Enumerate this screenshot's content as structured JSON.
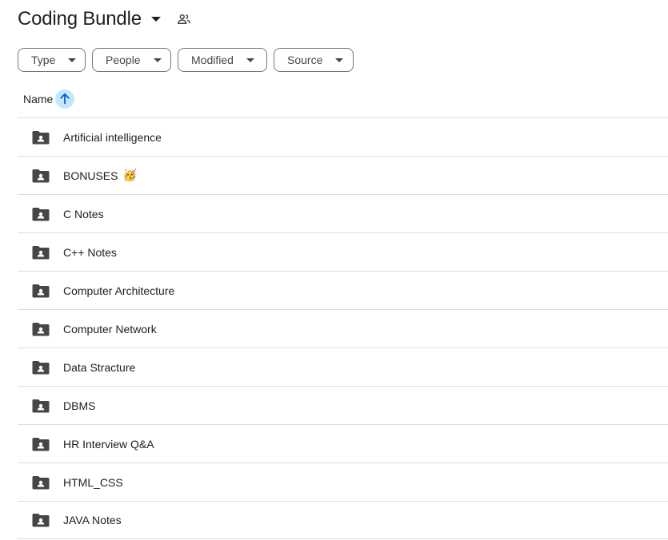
{
  "header": {
    "title": "Coding Bundle"
  },
  "filters": [
    {
      "label": "Type"
    },
    {
      "label": "People"
    },
    {
      "label": "Modified"
    },
    {
      "label": "Source"
    }
  ],
  "sort": {
    "column_label": "Name",
    "direction": "ascending"
  },
  "folders": [
    {
      "name": "Artificial intelligence",
      "icon": "shared-folder-icon"
    },
    {
      "name": "BONUSES",
      "emoji": "🥳",
      "icon": "shared-folder-icon"
    },
    {
      "name": "C Notes",
      "icon": "shared-folder-icon"
    },
    {
      "name": "C++ Notes",
      "icon": "shared-folder-icon"
    },
    {
      "name": "Computer Architecture",
      "icon": "shared-folder-icon"
    },
    {
      "name": "Computer Network",
      "icon": "shared-folder-icon"
    },
    {
      "name": "Data Stracture",
      "icon": "shared-folder-icon"
    },
    {
      "name": "DBMS",
      "icon": "shared-folder-icon"
    },
    {
      "name": "HR Interview Q&A",
      "icon": "shared-folder-icon"
    },
    {
      "name": "HTML_CSS",
      "icon": "shared-folder-icon"
    },
    {
      "name": "JAVA Notes",
      "icon": "shared-folder-icon"
    }
  ],
  "colors": {
    "sort_button_bg": "#c2e7ff",
    "folder_icon": "#444746",
    "divider": "#dadce0"
  }
}
